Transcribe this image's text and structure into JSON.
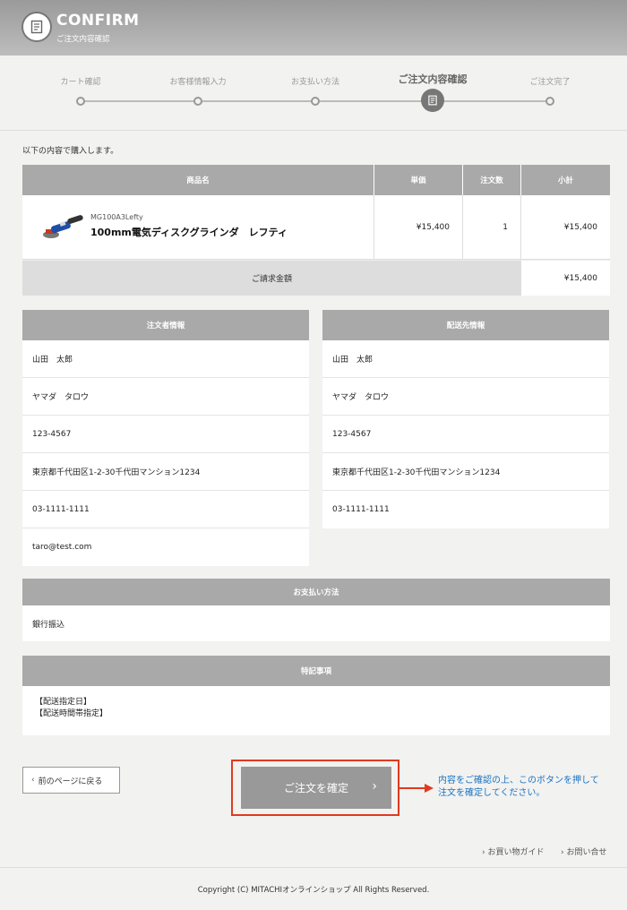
{
  "header": {
    "title": "CONFIRM",
    "subtitle": "ご注文内容確認",
    "icon": "document-icon"
  },
  "steps": [
    {
      "label": "カート確認",
      "active": false
    },
    {
      "label": "お客様情報入力",
      "active": false
    },
    {
      "label": "お支払い方法",
      "active": false
    },
    {
      "label": "ご注文内容確認",
      "active": true
    },
    {
      "label": "ご注文完了",
      "active": false
    }
  ],
  "intro": "以下の内容で購入します。",
  "order_table": {
    "headers": [
      "商品名",
      "単価",
      "注文数",
      "小計"
    ],
    "item": {
      "code": "MG100A3Lefty",
      "name": "100mm電気ディスクグラインダ　レフティ",
      "price": "¥15,400",
      "qty": "1",
      "subtotal": "¥15,400"
    },
    "total_label": "ご請求金額",
    "total_value": "¥15,400"
  },
  "orderer": {
    "title": "注文者情報",
    "rows": [
      "山田　太郎",
      "ヤマダ　タロウ",
      "123-4567",
      "東京都千代田区1-2-30千代田マンション1234",
      "03-1111-1111",
      "taro@test.com"
    ]
  },
  "shipping": {
    "title": "配送先情報",
    "rows": [
      "山田　太郎",
      "ヤマダ　タロウ",
      "123-4567",
      "東京都千代田区1-2-30千代田マンション1234",
      "03-1111-1111"
    ]
  },
  "payment": {
    "title": "お支払い方法",
    "value": "銀行振込"
  },
  "notes": {
    "title": "特記事項",
    "line1": "【配送指定日】",
    "line2": "【配送時間帯指定】"
  },
  "buttons": {
    "back": "前のページに戻る",
    "confirm": "ご注文を確定"
  },
  "annotation": {
    "line1": "内容をご確認の上、このボタンを押して",
    "line2": "注文を確定してください。"
  },
  "links": {
    "guide": "お買い物ガイド",
    "contact": "お問い合せ"
  },
  "footer": "Copyright (C) MITACHIオンラインショップ All Rights Reserved.",
  "colors": {
    "accent": "#e03a1f",
    "annotation": "#1a73c4",
    "header": "#a9a9a9"
  }
}
